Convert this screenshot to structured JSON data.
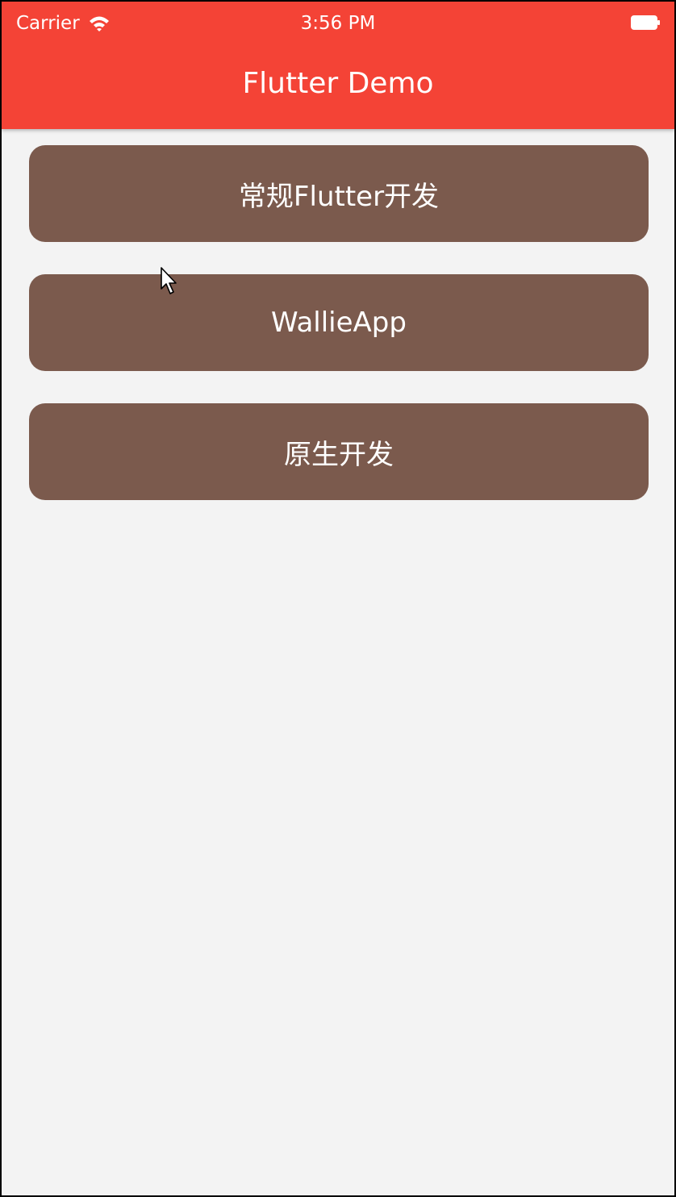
{
  "status_bar": {
    "carrier": "Carrier",
    "time": "3:56 PM",
    "wifi_icon": "wifi-icon",
    "battery_icon": "battery-icon"
  },
  "app_bar": {
    "title": "Flutter Demo",
    "color": "#f44336"
  },
  "buttons": [
    {
      "label": "常规Flutter开发",
      "color": "#7b5a4d"
    },
    {
      "label": "WallieApp",
      "color": "#7b5a4d"
    },
    {
      "label": "原生开发",
      "color": "#7b5a4d"
    }
  ],
  "background_color": "#f3f3f3"
}
